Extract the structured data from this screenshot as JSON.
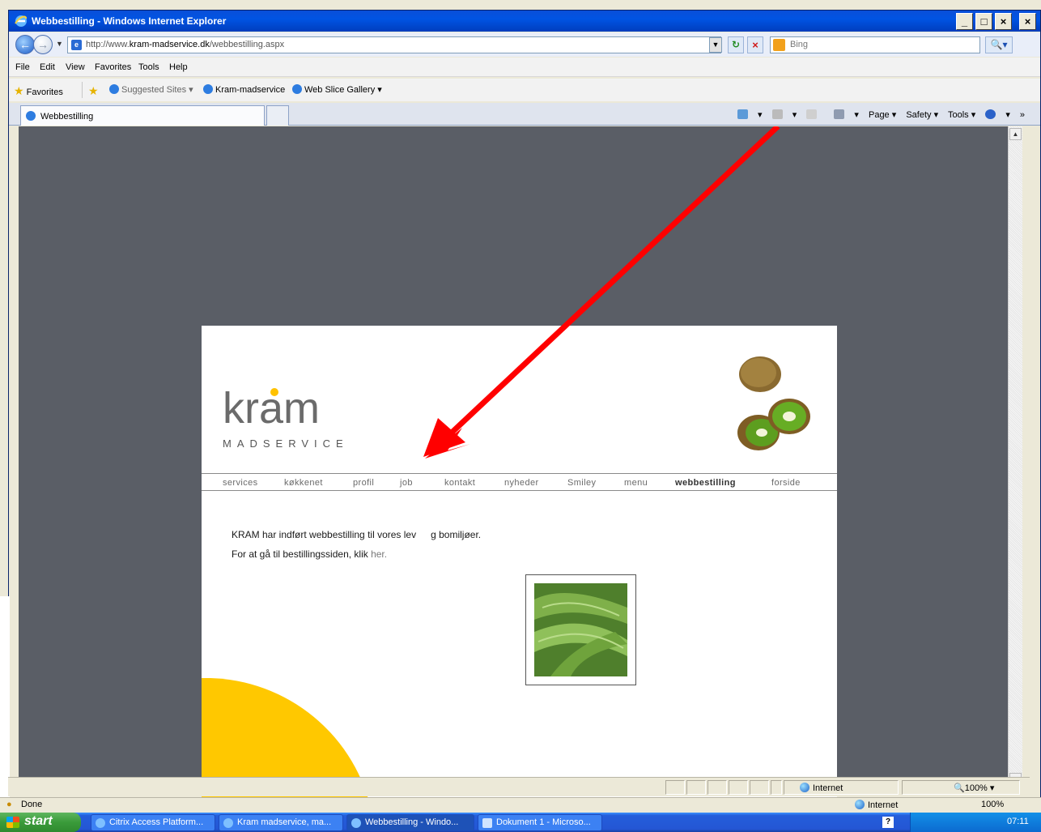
{
  "window": {
    "title": "Webbestilling - Windows Internet Explorer"
  },
  "address_bar": {
    "url_prefix": "http://www.",
    "url_domain": "kram-madservice.dk",
    "url_path": "/webbestilling.aspx",
    "search_placeholder": "Bing"
  },
  "menu": [
    "File",
    "Edit",
    "View",
    "Favorites",
    "Tools",
    "Help"
  ],
  "favorites_bar": {
    "favorites_label": "Favorites",
    "items": [
      "Suggested Sites ▾",
      "Kram-madservice",
      "Web Slice Gallery ▾"
    ]
  },
  "tab": {
    "title": "Webbestilling"
  },
  "command_bar": [
    "Page ▾",
    "Safety ▾",
    "Tools ▾"
  ],
  "site": {
    "logo_text": "kram",
    "logo_sub": "MADSERVICE",
    "nav": [
      "services",
      "køkkenet",
      "profil",
      "job",
      "kontakt",
      "nyheder",
      "Smiley",
      "menu",
      "webbestilling",
      "forside"
    ],
    "active_nav": "webbestilling",
    "intro": "KRAM har indført webbestilling til vores lev",
    "intro_tail": "g bomiljøer.",
    "order_text": "For at gå til bestillingssiden, klik ",
    "order_link": "her."
  },
  "status": {
    "zone": "Internet",
    "zoom": "100%",
    "done": "Done"
  },
  "taskbar": {
    "start": "start",
    "tasks": [
      "Citrix Access Platform...",
      "Kram madservice, ma...",
      "Webbestilling - Windo...",
      "Dokument 1 - Microso..."
    ],
    "clock": "07:11"
  },
  "colors": {
    "annotation": "#ff0000",
    "accent_yellow": "#ffc800",
    "viewport_bg": "#5a5e66"
  }
}
